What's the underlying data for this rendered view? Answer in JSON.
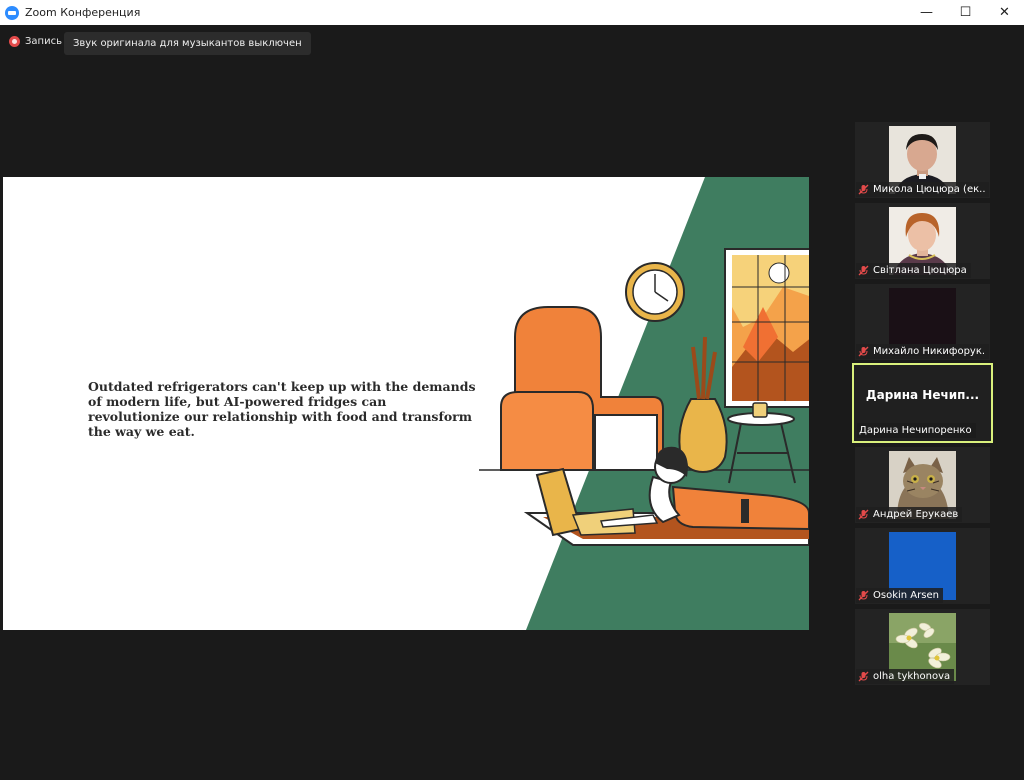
{
  "window": {
    "title": "Zoom Конференция"
  },
  "toolbar": {
    "recording_label": "Запись",
    "original_sound_label": "Звук оригинала для музыкантов выключен"
  },
  "slide": {
    "text": "Outdated refrigerators can't keep up with the demands of modern life, but AI-powered fridges can revolutionize our relationship with food and transform the way we eat."
  },
  "participants": [
    {
      "name": "Микола Цюцюра (ек...",
      "muted": true,
      "video": "photo"
    },
    {
      "name": "Світлана Цюцюра",
      "muted": true,
      "video": "photo"
    },
    {
      "name": "Михайло Никифорук...",
      "muted": true,
      "video": "dark"
    },
    {
      "name": "Дарина Нечипоренко",
      "display_name": "Дарина  Нечип...",
      "muted": false,
      "active_speaker": true,
      "video": "off"
    },
    {
      "name": "Андрей Ерукаев",
      "muted": true,
      "video": "cat"
    },
    {
      "name": "Osokin Arsen",
      "muted": true,
      "video": "blue"
    },
    {
      "name": "olha tykhonova",
      "muted": true,
      "video": "flowers"
    }
  ],
  "colors": {
    "active_speaker_border": "#d9f07c",
    "muted_icon": "#e34a4a",
    "slide_green": "#3f7d60",
    "slide_orange": "#f0823a"
  }
}
